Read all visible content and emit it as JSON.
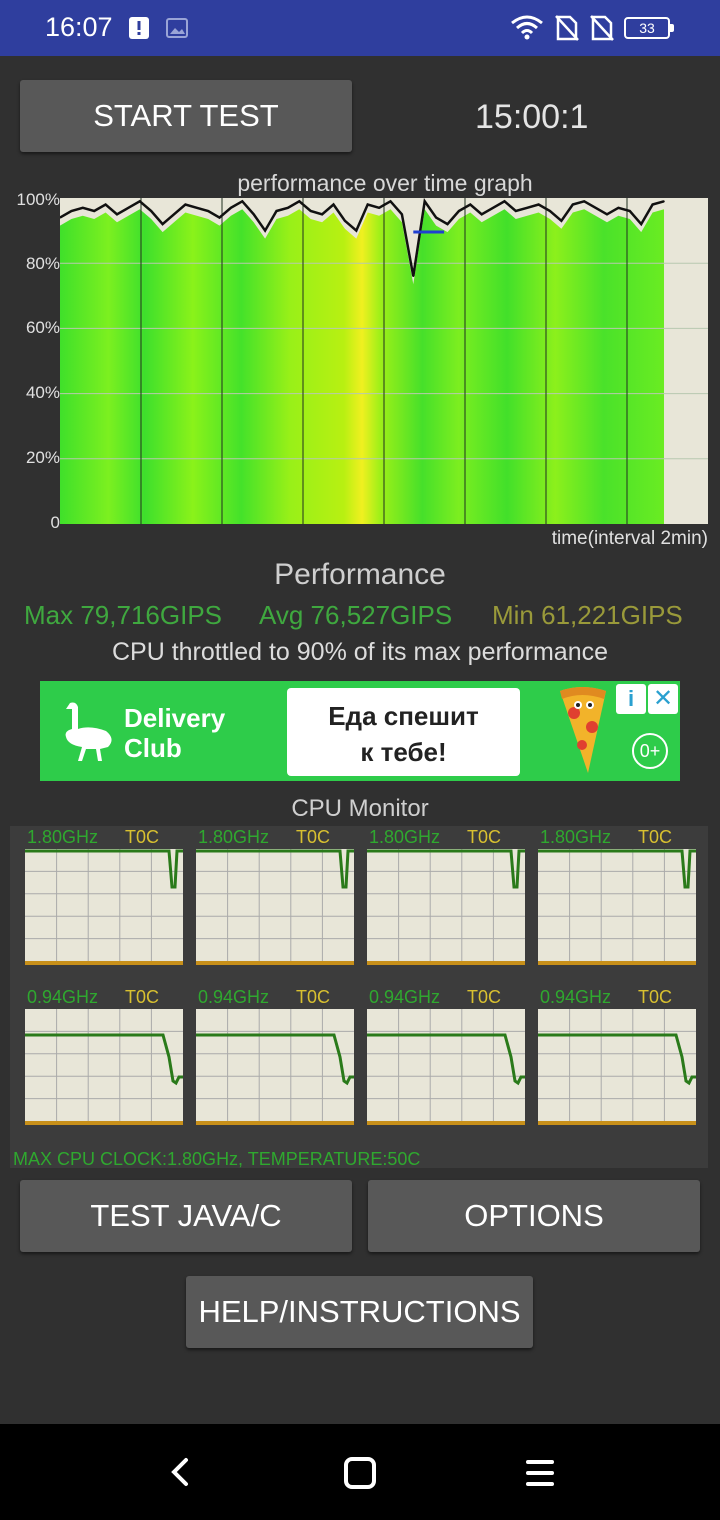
{
  "status_bar": {
    "time": "16:07",
    "battery": "33",
    "icons": [
      "alert-icon",
      "image-icon",
      "wifi-icon",
      "no-sim-icon",
      "no-sim-icon",
      "battery-icon"
    ]
  },
  "controls": {
    "start_label": "START TEST",
    "timer": "15:00:1"
  },
  "graph": {
    "title": "performance over time graph",
    "y_ticks": [
      "100%",
      "80%",
      "60%",
      "40%",
      "20%",
      "0"
    ],
    "time_label": "time(interval 2min)"
  },
  "chart_data": {
    "type": "line",
    "title": "performance over time graph",
    "xlabel": "time(interval 2min)",
    "ylabel": "",
    "ylim": [
      0,
      100
    ],
    "grid": true,
    "series": [
      {
        "values": [
          94,
          96,
          97,
          96,
          98,
          95,
          97,
          99,
          96,
          92,
          95,
          98,
          97,
          96,
          94,
          97,
          99,
          95,
          90,
          96,
          97,
          99,
          96,
          95,
          98,
          93,
          90,
          98,
          97,
          99,
          95,
          76,
          99,
          94,
          92,
          96,
          98,
          95,
          97,
          99,
          96,
          97,
          98,
          96,
          93,
          98,
          99,
          97,
          95,
          97,
          96,
          92,
          98,
          99
        ]
      }
    ]
  },
  "performance": {
    "title": "Performance",
    "max": "Max 79,716GIPS",
    "avg": "Avg 76,527GIPS",
    "min": "Min 61,221GIPS",
    "throttle": "CPU throttled to 90% of its max performance",
    "colors": {
      "max": "#3fa83f",
      "avg": "#3fa83f",
      "min": "#9a9a3a"
    }
  },
  "ad": {
    "brand_line1": "Delivery",
    "brand_line2": "Club",
    "text_line1": "Еда спешит",
    "text_line2": "к тебе!",
    "age": "0+",
    "info": "i",
    "close": "✕"
  },
  "cpu_monitor": {
    "title": "CPU Monitor",
    "cores": [
      {
        "freq": "1.80GHz",
        "temp": "T0C"
      },
      {
        "freq": "1.80GHz",
        "temp": "T0C"
      },
      {
        "freq": "1.80GHz",
        "temp": "T0C"
      },
      {
        "freq": "1.80GHz",
        "temp": "T0C"
      },
      {
        "freq": "0.94GHz",
        "temp": "T0C"
      },
      {
        "freq": "0.94GHz",
        "temp": "T0C"
      },
      {
        "freq": "0.94GHz",
        "temp": "T0C"
      },
      {
        "freq": "0.94GHz",
        "temp": "T0C"
      }
    ],
    "footer": "MAX CPU CLOCK:1.80GHz, TEMPERATURE:50C"
  },
  "buttons": {
    "java": "TEST JAVA/C",
    "options": "OPTIONS",
    "help": "HELP/INSTRUCTIONS"
  },
  "nav": {
    "back": "back-icon",
    "home": "home-icon",
    "menu": "menu-icon"
  }
}
